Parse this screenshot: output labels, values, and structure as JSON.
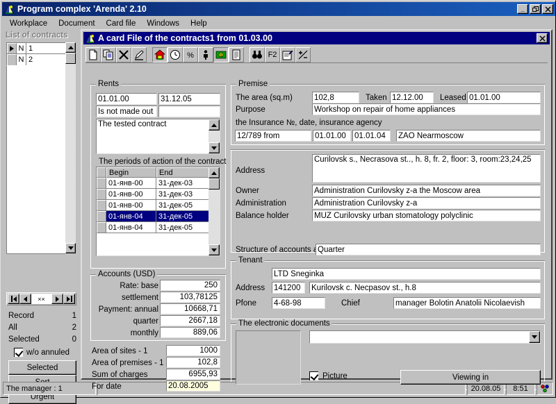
{
  "window": {
    "title": "Program complex 'Arenda' 2.10",
    "icon": "app-pyramid-icon",
    "buttons": {
      "minimize": "_",
      "maximize": "❐",
      "close": "×"
    }
  },
  "menu": {
    "items": [
      {
        "label": "Workplace"
      },
      {
        "label": "Document"
      },
      {
        "label": "Card file"
      },
      {
        "label": "Windows"
      },
      {
        "label": "Help"
      }
    ]
  },
  "left_panel": {
    "caption": "List of contracts",
    "grid": {
      "rows": [
        {
          "marker": true,
          "n": "N",
          "value": "1"
        },
        {
          "marker": false,
          "n": "N",
          "value": "2"
        }
      ]
    },
    "navigator": {
      "field": "××"
    },
    "stats": [
      {
        "label": "Record",
        "value": "1"
      },
      {
        "label": "All",
        "value": "2"
      },
      {
        "label": "Selected",
        "value": "0"
      }
    ],
    "checkbox": {
      "label": "w/o annuled",
      "checked": true
    },
    "buttons": [
      {
        "label": "Selected"
      },
      {
        "label": "Sort"
      },
      {
        "label": "Urgent"
      }
    ]
  },
  "mdi": {
    "title": "A card File of the contracts1 from 01.03.00",
    "icon": "app-pyramid-icon",
    "close_label": "×",
    "toolbar": [
      {
        "name": "new-document-icon",
        "state": "raised"
      },
      {
        "name": "copy-icon",
        "state": "raised"
      },
      {
        "name": "delete-cross-icon",
        "state": "raised"
      },
      {
        "name": "edit-pencil-icon",
        "state": "raised"
      },
      {
        "name": "separator",
        "state": "sep"
      },
      {
        "name": "house-icon",
        "state": "pressed"
      },
      {
        "name": "clock-icon",
        "state": "raised"
      },
      {
        "name": "percent-icon",
        "state": "raised"
      },
      {
        "name": "person-icon",
        "state": "raised"
      },
      {
        "name": "money-icon",
        "state": "pressed"
      },
      {
        "name": "report-icon",
        "state": "raised"
      },
      {
        "name": "separator",
        "state": "sep"
      },
      {
        "name": "binoculars-search-icon",
        "state": "raised"
      },
      {
        "name": "f2-key-icon",
        "state": "raised",
        "text": "F2"
      },
      {
        "name": "properties-icon",
        "state": "raised"
      },
      {
        "name": "plus-minus-icon",
        "state": "raised"
      }
    ],
    "rents": {
      "caption": "Rents",
      "date_from": "01.01.00",
      "date_to": "31.12.05",
      "status": "Is not made out",
      "status_extra": "",
      "note": "The tested contract"
    },
    "periods": {
      "caption": "The periods of action of the contract",
      "columns": [
        "Begin",
        "End"
      ],
      "rows": [
        {
          "begin": "01-янв-00",
          "end": "31-дек-03",
          "selected": false
        },
        {
          "begin": "01-янв-00",
          "end": "31-дек-03",
          "selected": false
        },
        {
          "begin": "01-янв-00",
          "end": "31-дек-05",
          "selected": false
        },
        {
          "begin": "01-янв-04",
          "end": "31-дек-05",
          "selected": true
        },
        {
          "begin": "01-янв-04",
          "end": "31-дек-05",
          "selected": false
        }
      ]
    },
    "accounts": {
      "caption": "Accounts (USD)",
      "rows": [
        {
          "label": "Rate: base",
          "value": "250"
        },
        {
          "label": "settlement",
          "value": "103,78125"
        },
        {
          "label": "Payment: annual",
          "value": "10668,71"
        },
        {
          "label": "quarter",
          "value": "2667,18"
        },
        {
          "label": "monthly",
          "value": "889,06"
        }
      ]
    },
    "totals": [
      {
        "label": "Area of sites - 1",
        "value": "1000",
        "highlight": false
      },
      {
        "label": "Area of premises - 1",
        "value": "102,8",
        "highlight": false
      },
      {
        "label": "Sum of charges",
        "value": "6955,93",
        "highlight": false
      },
      {
        "label": "For date",
        "value": "20.08.2005",
        "highlight": true
      }
    ],
    "premise": {
      "caption": "Premise",
      "area_label": "The area (sq.m)",
      "area_value": "102,8",
      "taken_label": "Taken",
      "taken_value": "12.12.00",
      "leased_label": "Leased",
      "leased_value": "01.01.00",
      "purpose_label": "Purpose",
      "purpose_value": "Workshop on repair of home appliances",
      "insurance_label": "the Insurance №, date, insurance agency",
      "insurance_number": "12/789 from",
      "insurance_date1": "01.01.00",
      "insurance_date2": "01.01.04",
      "insurance_agency": "ZAO Nearmoscow"
    },
    "property": {
      "address_label": "Address",
      "address_value": "Curilovsk s., Necrasova st.., h. 8, fr. 2, floor: 3, room:23,24,25",
      "owner_label": "Owner",
      "owner_value": "Administration Curilovsky z-a the Moscow area",
      "administration_label": "Administration",
      "administration_value": "Administration Curilovsky z-a",
      "balance_label": "Balance holder",
      "balance_value": "MUZ Curilovsky urban stomatology polyclinic"
    },
    "structure": {
      "label": "Structure of accounts and fir",
      "value": "Quarter"
    },
    "tenant": {
      "caption": "Tenant",
      "name": "LTD Sneginka",
      "address_label": "Address",
      "postcode": "141200",
      "address_value": "Kurilovsk c. Necpasov st., h.8",
      "phone_label": "Pfone",
      "phone_value": "4-68-98",
      "chief_label": "Chief",
      "chief_value": "manager Bolotin Anatolii Nicolaevish"
    },
    "documents": {
      "caption": "The electronic documents",
      "combo_value": "",
      "picture_label": "Picture",
      "picture_checked": true,
      "view_button": "Viewing in"
    }
  },
  "statusbar": {
    "manager": "The manager : 1",
    "middle": "",
    "date": "20.08.05",
    "time": "8:51",
    "tray_icon": "network-icon"
  }
}
